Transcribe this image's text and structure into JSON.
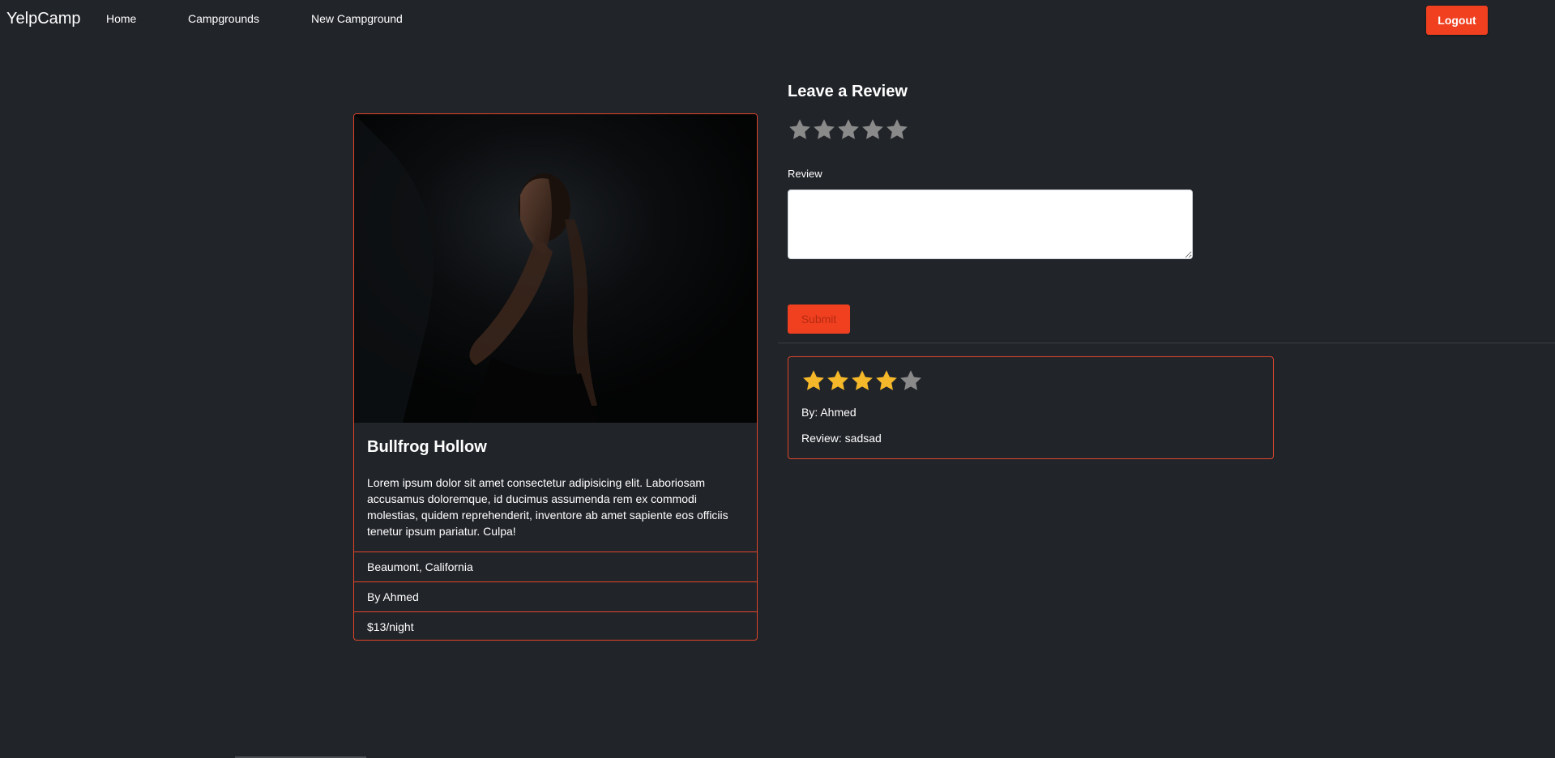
{
  "navbar": {
    "brand": "YelpCamp",
    "links": [
      "Home",
      "Campgrounds",
      "New Campground"
    ],
    "logout_label": "Logout"
  },
  "campground": {
    "title": "Bullfrog Hollow",
    "description": "Lorem ipsum dolor sit amet consectetur adipisicing elit. Laboriosam accusamus doloremque, id ducimus assumenda rem ex commodi molestias, quidem reprehenderit, inventore ab amet sapiente eos officiis tenetur ipsum pariatur. Culpa!",
    "location": "Beaumont, California",
    "author": "By Ahmed",
    "price": "$13/night"
  },
  "review_form": {
    "heading": "Leave a Review",
    "rating_value": 0,
    "rating_max": 5,
    "review_label": "Review",
    "review_value": "",
    "submit_label": "Submit"
  },
  "reviews": [
    {
      "rating": 4,
      "rating_max": 5,
      "author": "By: Ahmed",
      "text": "Review: sadsad"
    }
  ],
  "colors": {
    "background": "#212429",
    "accent": "#f04020",
    "border": "#e0462a",
    "star_filled": "#f5b82a",
    "star_empty": "#8a8a8a"
  }
}
